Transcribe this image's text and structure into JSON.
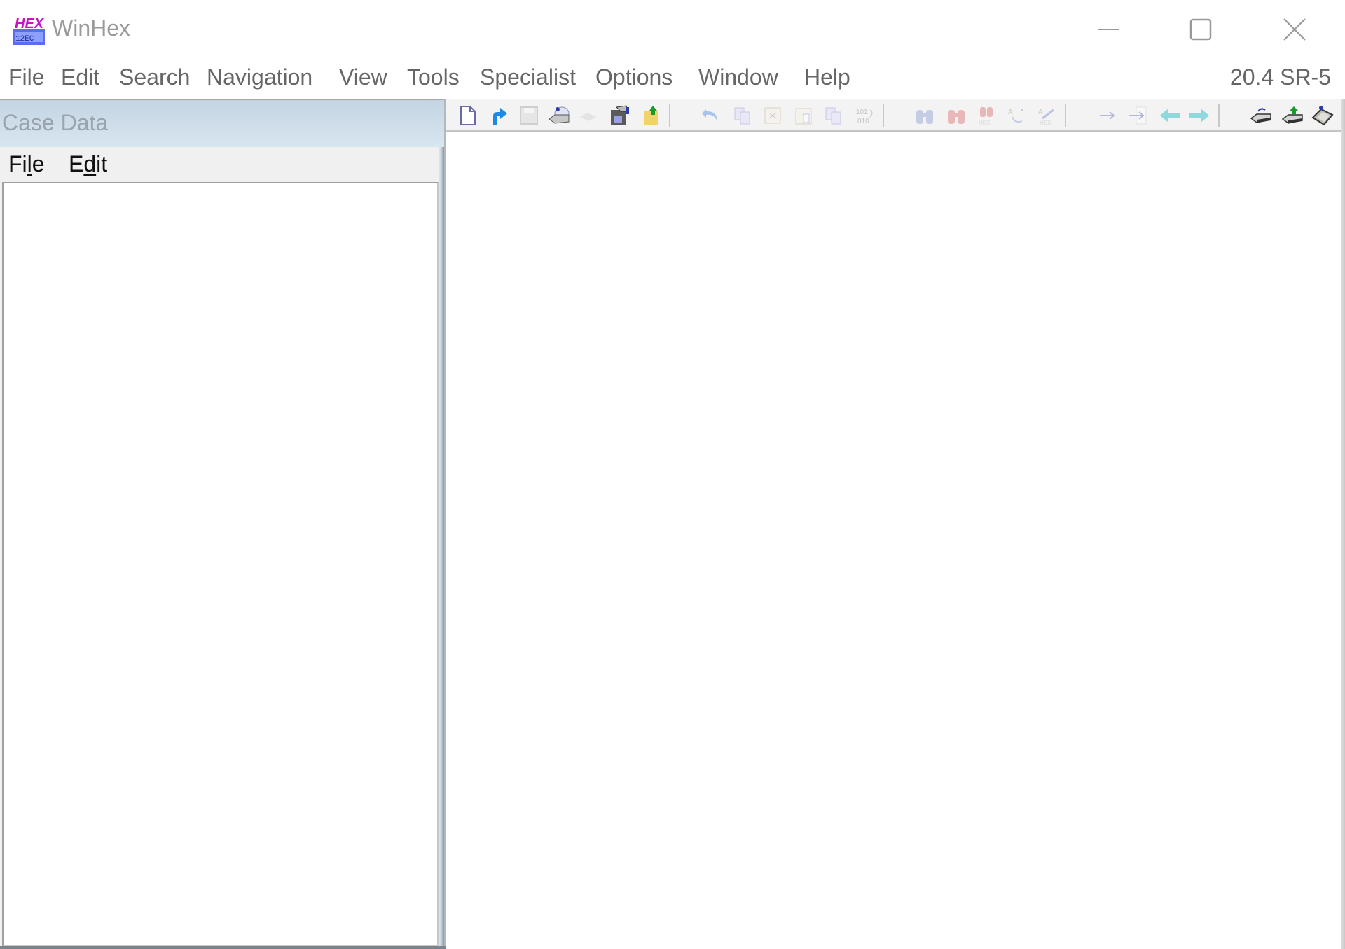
{
  "window": {
    "title": "WinHex",
    "icon": "winhex-logo-icon",
    "controls": {
      "minimize": "minimize-icon",
      "maximize": "maximize-icon",
      "close": "close-icon"
    }
  },
  "menubar": {
    "items": [
      {
        "label": "File"
      },
      {
        "label": "Edit"
      },
      {
        "label": "Search"
      },
      {
        "label": "Navigation"
      },
      {
        "label": "View"
      },
      {
        "label": "Tools"
      },
      {
        "label": "Specialist"
      },
      {
        "label": "Options"
      },
      {
        "label": "Window"
      },
      {
        "label": "Help"
      }
    ],
    "version": "20.4 SR-5"
  },
  "case_panel": {
    "title": "Case Data",
    "menu": [
      {
        "label_pre": "Fi",
        "label_u": "l",
        "label_post": "e"
      },
      {
        "label_pre": "E",
        "label_u": "d",
        "label_post": "it"
      }
    ]
  },
  "toolbar": {
    "groups": [
      [
        "new-file-icon",
        "open-file-icon",
        "save-file-icon",
        "open-disk-icon",
        "disabled-icon",
        "properties-icon",
        "export-icon"
      ],
      [
        "undo-icon",
        "copy-icon",
        "cut-icon",
        "paste-icon",
        "paste-special-icon",
        "convert-icon"
      ],
      [
        "find-text-icon",
        "find-hex-icon",
        "replace-hex-icon",
        "replace-text-icon",
        "replace-hex2-icon"
      ],
      [
        "goto-offset-icon",
        "goto-sector-icon",
        "back-icon",
        "forward-icon"
      ],
      [
        "open-drive-icon",
        "clone-disk-icon",
        "disk-tools-icon"
      ]
    ],
    "colors": {
      "accent_blue": "#1e88e5",
      "arrow_cyan": "#8fd8dc",
      "folder_yellow": "#f2d26a",
      "disabled_gray": "#c8c8d8"
    }
  }
}
